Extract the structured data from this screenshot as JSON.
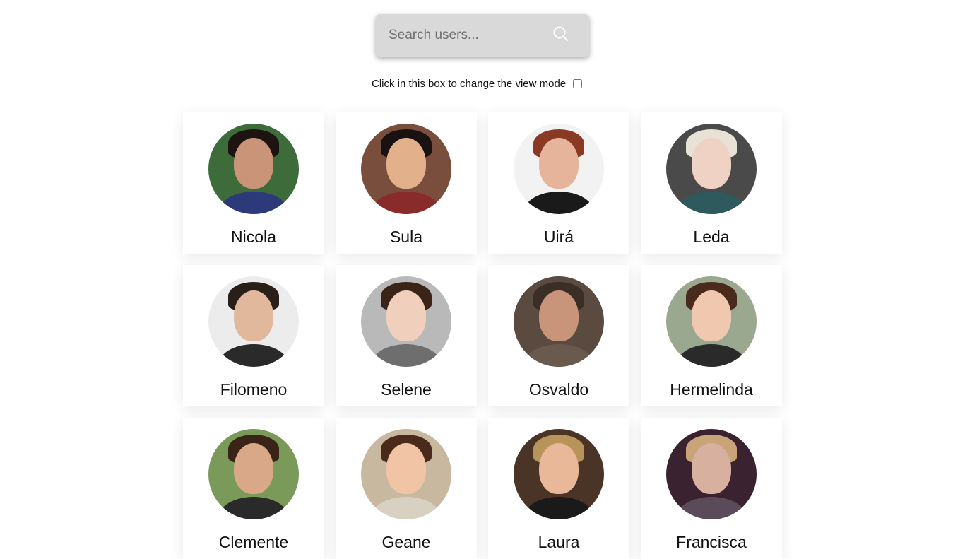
{
  "search": {
    "placeholder": "Search users..."
  },
  "view_mode": {
    "label": "Click in this box to change the view mode",
    "checked": false
  },
  "users": [
    {
      "name": "Nicola",
      "colors": {
        "bg": "#3d6b3a",
        "skin": "#c99478",
        "hair": "#1d1412",
        "body": "#2c3a7a"
      }
    },
    {
      "name": "Sula",
      "colors": {
        "bg": "#7a4e3c",
        "skin": "#e3b08c",
        "hair": "#1a1210",
        "body": "#8a2b2b"
      }
    },
    {
      "name": "Uirá",
      "colors": {
        "bg": "#f2f2f2",
        "skin": "#e6b49a",
        "hair": "#8a3a24",
        "body": "#1a1a1a"
      }
    },
    {
      "name": "Leda",
      "colors": {
        "bg": "#4a4a4a",
        "skin": "#efd2c4",
        "hair": "#e8e2d6",
        "body": "#2e5a5e"
      }
    },
    {
      "name": "Filomeno",
      "colors": {
        "bg": "#ececec",
        "skin": "#e2b89c",
        "hair": "#2a1e18",
        "body": "#2a2a2a"
      }
    },
    {
      "name": "Selene",
      "colors": {
        "bg": "#b9b9b9",
        "skin": "#f0d0bc",
        "hair": "#3a2418",
        "body": "#6e6e6e"
      }
    },
    {
      "name": "Osvaldo",
      "colors": {
        "bg": "#5a4a40",
        "skin": "#c8957a",
        "hair": "#3a2e26",
        "body": "#6a5a4e"
      }
    },
    {
      "name": "Hermelinda",
      "colors": {
        "bg": "#9aa890",
        "skin": "#f0c8b0",
        "hair": "#4a2a1c",
        "body": "#2a2a2a"
      }
    },
    {
      "name": "Clemente",
      "colors": {
        "bg": "#7a9a5a",
        "skin": "#d8a888",
        "hair": "#3a2418",
        "body": "#2a2a2a"
      }
    },
    {
      "name": "Geane",
      "colors": {
        "bg": "#c8b8a0",
        "skin": "#f0c4a4",
        "hair": "#4a2a1a",
        "body": "#d8d0c0"
      }
    },
    {
      "name": "Laura",
      "colors": {
        "bg": "#4a3426",
        "skin": "#e8b898",
        "hair": "#b8945a",
        "body": "#1a1a1a"
      }
    },
    {
      "name": "Francisca",
      "colors": {
        "bg": "#3a2230",
        "skin": "#d8b0a0",
        "hair": "#c8a478",
        "body": "#5a4a5a"
      }
    }
  ]
}
